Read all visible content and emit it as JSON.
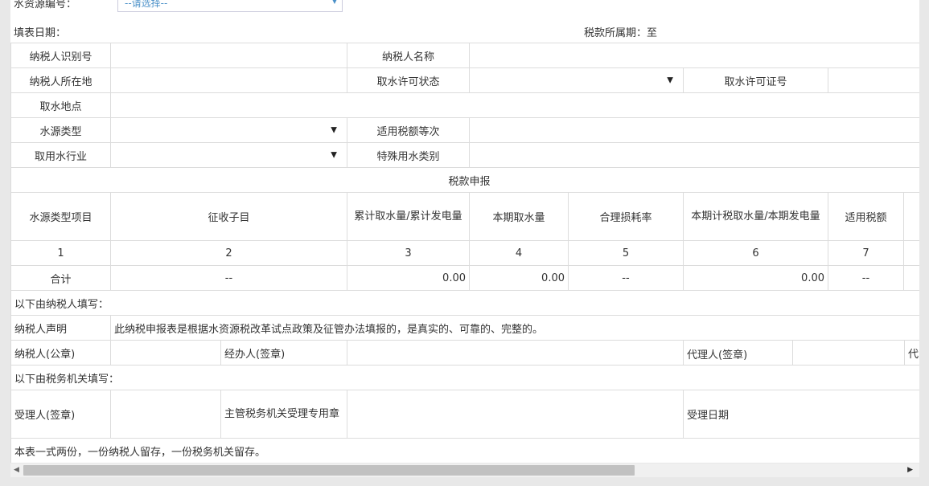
{
  "top": {
    "water_source_no_label": "水资源编号：",
    "select_placeholder": "--请选择--"
  },
  "header": {
    "fill_date_label": "填表日期：",
    "tax_period_label": "税款所属期：至"
  },
  "info": {
    "taxpayer_id": "纳税人识别号",
    "taxpayer_name": "纳税人名称",
    "taxpayer_location": "纳税人所在地",
    "permit_status": "取水许可状态",
    "permit_no": "取水许可证号",
    "intake_location": "取水地点",
    "source_type": "水源类型",
    "tax_grade": "适用税额等次",
    "industry": "取用水行业",
    "special_category": "特殊用水类别"
  },
  "declaration": {
    "section_title": "税款申报",
    "columns": [
      "水源类型项目",
      "征收子目",
      "累计取水量/累计发电量",
      "本期取水量",
      "合理损耗率",
      "本期计税取水量/本期发电量",
      "适用税额"
    ],
    "numbers": [
      "1",
      "2",
      "3",
      "4",
      "5",
      "6",
      "7"
    ],
    "total_label": "合计",
    "totals": [
      "--",
      "0.00",
      "0.00",
      "--",
      "0.00",
      "--"
    ]
  },
  "taxpayer_section": {
    "title": "以下由纳税人填写：",
    "statement_label": "纳税人声明",
    "statement_text": "此纳税申报表是根据水资源税改革试点政策及征管办法填报的，是真实的、可靠的、完整的。",
    "seal_label": "纳税人(公章)",
    "handler_label": "经办人(签章)",
    "agent_label": "代理人(签章)",
    "agent_more": "代"
  },
  "tax_office_section": {
    "title": "以下由税务机关填写：",
    "receiver_label": "受理人(签章)",
    "office_seal_label": "主管税务机关受理专用章",
    "accept_date_label": "受理日期"
  },
  "footer_note": "本表一式两份，一份纳税人留存，一份税务机关留存。",
  "icons": {
    "dropdown": "dropdown-arrow-icon",
    "scroll_left": "scroll-left-icon",
    "scroll_right": "scroll-right-icon"
  }
}
